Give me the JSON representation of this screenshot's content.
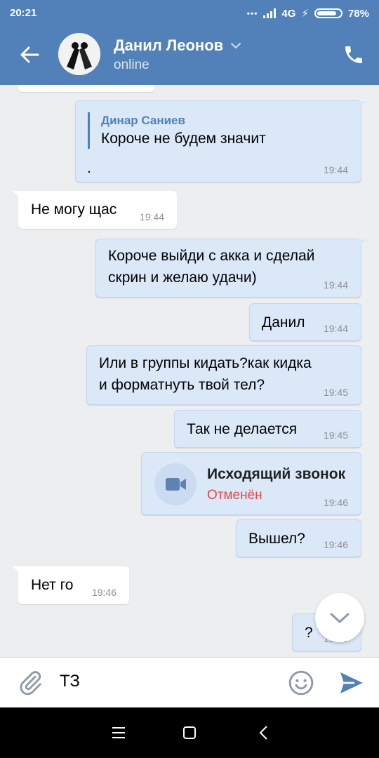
{
  "status_bar": {
    "time": "20:21",
    "network": "4G",
    "battery": "78%"
  },
  "header": {
    "contact_name": "Данил Леонов",
    "presence": "online"
  },
  "messages": [
    {
      "direction": "out",
      "forward_from": "Динар Саниев",
      "text": "Короче не будем значит",
      "extra": ".",
      "time": "19:44"
    },
    {
      "direction": "in",
      "text": "Не могу щас",
      "time": "19:44"
    },
    {
      "direction": "out",
      "text_line1": "Короче выйди с акка и сделай",
      "text_line2": "скрин и желаю удачи)",
      "time": "19:44"
    },
    {
      "direction": "out",
      "text": "Данил",
      "time": "19:44"
    },
    {
      "direction": "out",
      "text_line1": "Или в группы кидать?как кидка",
      "text_line2": "и форматнуть твой тел?",
      "time": "19:45"
    },
    {
      "direction": "out",
      "text": "Так не делается",
      "time": "19:45"
    },
    {
      "direction": "out",
      "call_title": "Исходящий звонок",
      "call_status": "Отменён",
      "time": "19:46"
    },
    {
      "direction": "out",
      "text": "Вышел?",
      "time": "19:46"
    },
    {
      "direction": "in",
      "text": "Нет го",
      "time": "19:46"
    },
    {
      "direction": "out",
      "text": "?",
      "time": "19:46"
    }
  ],
  "input": {
    "value": "ТЗ"
  },
  "colors": {
    "accent": "#5181b8",
    "outgoing_bubble": "#dbe8f8",
    "incoming_bubble": "#ffffff",
    "call_cancelled": "#e64646",
    "background": "#edeef0"
  },
  "icons": {
    "back": "arrow-left-icon",
    "call": "phone-icon",
    "attach": "paperclip-icon",
    "emoji": "smiley-icon",
    "send": "send-icon",
    "scroll": "chevron-down-icon"
  }
}
